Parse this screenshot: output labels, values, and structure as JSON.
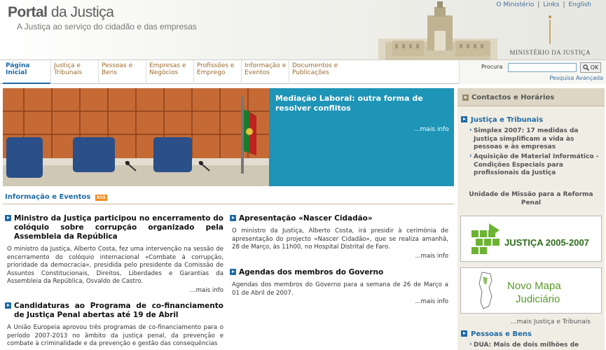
{
  "header": {
    "title_bold": "Portal",
    "title_rest": " da Justiça",
    "tagline": "A Justiça ao serviço do cidadão e das empresas",
    "top_links": [
      "O Ministério",
      "Links",
      "English"
    ],
    "ministry": "MINISTÉRIO DA JUSTIÇA"
  },
  "nav": {
    "items": [
      {
        "label": "Página Inicial"
      },
      {
        "label": "Justiça e Tribunais"
      },
      {
        "label": "Pessoas e Bens"
      },
      {
        "label": "Empresas e Negócios"
      },
      {
        "label": "Profissões e Emprego"
      },
      {
        "label": "Informação e Eventos"
      },
      {
        "label": "Documentos e Publicações"
      }
    ]
  },
  "search": {
    "label": "Procura",
    "value": "",
    "button": "OK",
    "advanced": "Pesquisa Avançada"
  },
  "banner": {
    "title": "Mediação Laboral: outra forma de resolver conflitos",
    "more": "...mais info"
  },
  "section": {
    "title": "Informação e Eventos",
    "rss": "RSS"
  },
  "news": [
    {
      "title": "Ministro da Justiça participou no encerramento do colóquio sobre corrupção organizado pela Assembleia da República",
      "body": "O ministro da Justiça, Alberto Costa, fez uma intervenção na sessão de encerramento do colóquio internacional «Combate à corrupção, prioridade da democracia», presidida pelo presidente da Comissão de Assuntos Constitucionais, Direitos, Liberdades e Garantias da Assembleia da República, Osvaldo de Castro.",
      "more": "...mais info"
    },
    {
      "title": "Candidaturas ao Programa de co-financiamento de Justiça Penal abertas até 19 de Abril",
      "body": "A União Europeia aprovou três programas de co-financiamento para o período 2007-2013 no âmbito da justiça penal, da prevenção e combate à criminalidade e da prevenção e gestão das consequências",
      "more": ""
    },
    {
      "title": "Apresentação «Nascer Cidadão»",
      "body": "O ministro da Justiça, Alberto Costa, irá presidir à cerimónia de apresentação do projecto «Nascer Cidadão», que se realiza amanhã, 28 de Março, às 11h00, no Hospital Distrital de Faro.",
      "more": "...mais info"
    },
    {
      "title": "Agendas dos membros do Governo",
      "body": "Agendas dos membros do Governo para a semana de 26 de Março a 01 de Abril de 2007.",
      "more": "...mais info"
    }
  ],
  "sidebar": {
    "contacts": "Contactos e Horários",
    "section1": {
      "title": "Justiça e Tribunais",
      "links": [
        "Simplex 2007: 17 medidas da Justiça simplificam a vida às pessoas e às empresas",
        "Aquisição de Material Informático - Condições Especiais para profissionais da Justiça"
      ]
    },
    "missao": "Unidade de Missão para a Reforma Penal",
    "logo1": "JUSTIÇA 2005-2007",
    "logo2_line1": "Novo Mapa",
    "logo2_line2": "Judiciário",
    "more": "...mais Justiça e Tribunais",
    "section2": {
      "title": "Pessoas e Bens",
      "links": [
        "DUA: Mais de dois milhões de"
      ]
    }
  },
  "colors": {
    "accent": "#1f6aa5",
    "banner": "#1e94b6",
    "nav_text": "#9b6b2f",
    "logo_green": "#6cb332"
  }
}
